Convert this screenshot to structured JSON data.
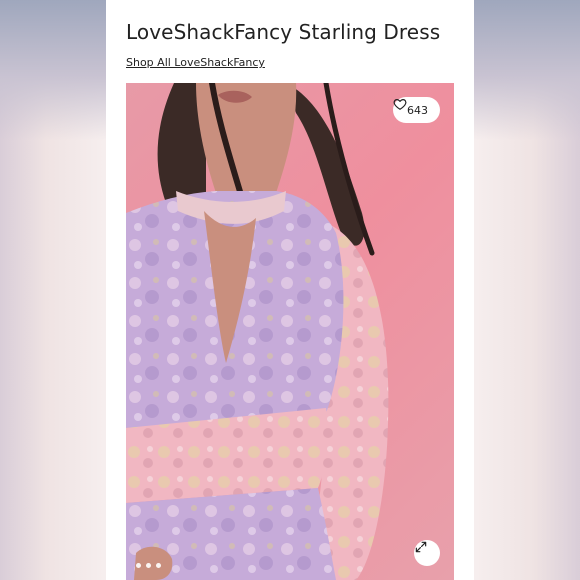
{
  "listing": {
    "title": "LoveShackFancy Starling Dress",
    "shop_link_label": "Shop All LoveShackFancy",
    "like_count": "643",
    "image_count": 3,
    "current_image_index": 1
  },
  "colors": {
    "backdrop_pink": "#ef8f9e",
    "dress_lavender": "#c6a8d8",
    "waist_pink": "#f0b4bf",
    "card_background": "#ffffff"
  },
  "icons": {
    "like": "heart-icon",
    "expand": "expand-icon"
  }
}
